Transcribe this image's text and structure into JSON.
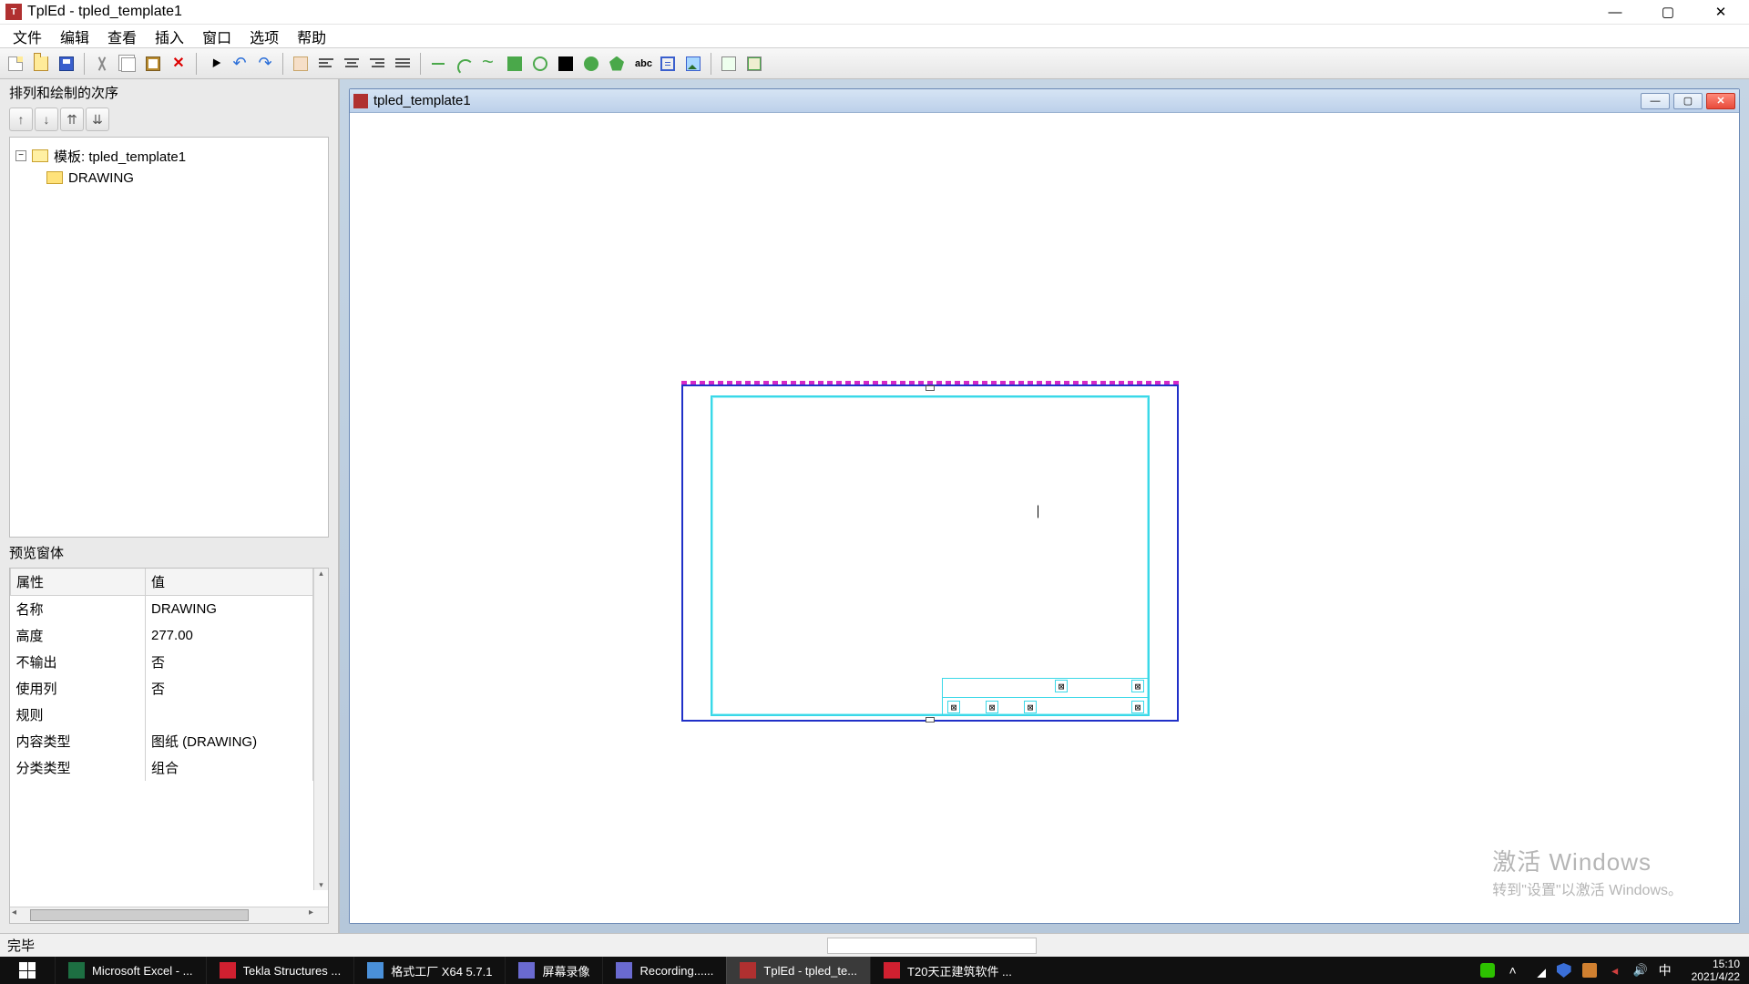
{
  "window": {
    "title": "TplEd - tpled_template1"
  },
  "menu": {
    "file": "文件",
    "edit": "编辑",
    "view": "查看",
    "insert": "插入",
    "window": "窗口",
    "options": "选项",
    "help": "帮助"
  },
  "side": {
    "panel_title": "排列和绘制的次序",
    "tree_root": "模板: tpled_template1",
    "tree_child": "DRAWING",
    "preview_title": "预览窗体",
    "header_prop": "属性",
    "header_val": "值",
    "rows": [
      {
        "k": "名称",
        "v": "DRAWING"
      },
      {
        "k": "高度",
        "v": "277.00"
      },
      {
        "k": "不输出",
        "v": "否"
      },
      {
        "k": "使用列",
        "v": "否"
      },
      {
        "k": "规则",
        "v": ""
      },
      {
        "k": "内容类型",
        "v": "图纸 (DRAWING)"
      },
      {
        "k": "分类类型",
        "v": "组合"
      }
    ]
  },
  "mdi": {
    "title": "tpled_template1"
  },
  "watermark": {
    "line1": "激活 Windows",
    "line2": "转到\"设置\"以激活 Windows。"
  },
  "status": {
    "text": "完毕"
  },
  "taskbar": {
    "items": [
      {
        "label": "Microsoft Excel - ...",
        "color": "#1d6f42"
      },
      {
        "label": "Tekla Structures ...",
        "color": "#d02030"
      },
      {
        "label": "格式工厂 X64 5.7.1",
        "color": "#4a90d9"
      },
      {
        "label": "屏幕录像",
        "color": "#6a6ad0"
      },
      {
        "label": "Recording......",
        "color": "#6a6ad0"
      },
      {
        "label": "TplEd - tpled_te...",
        "color": "#b03030"
      },
      {
        "label": "T20天正建筑软件 ...",
        "color": "#d02030"
      }
    ],
    "ime": "中",
    "time": "15:10",
    "date": "2021/4/22"
  }
}
